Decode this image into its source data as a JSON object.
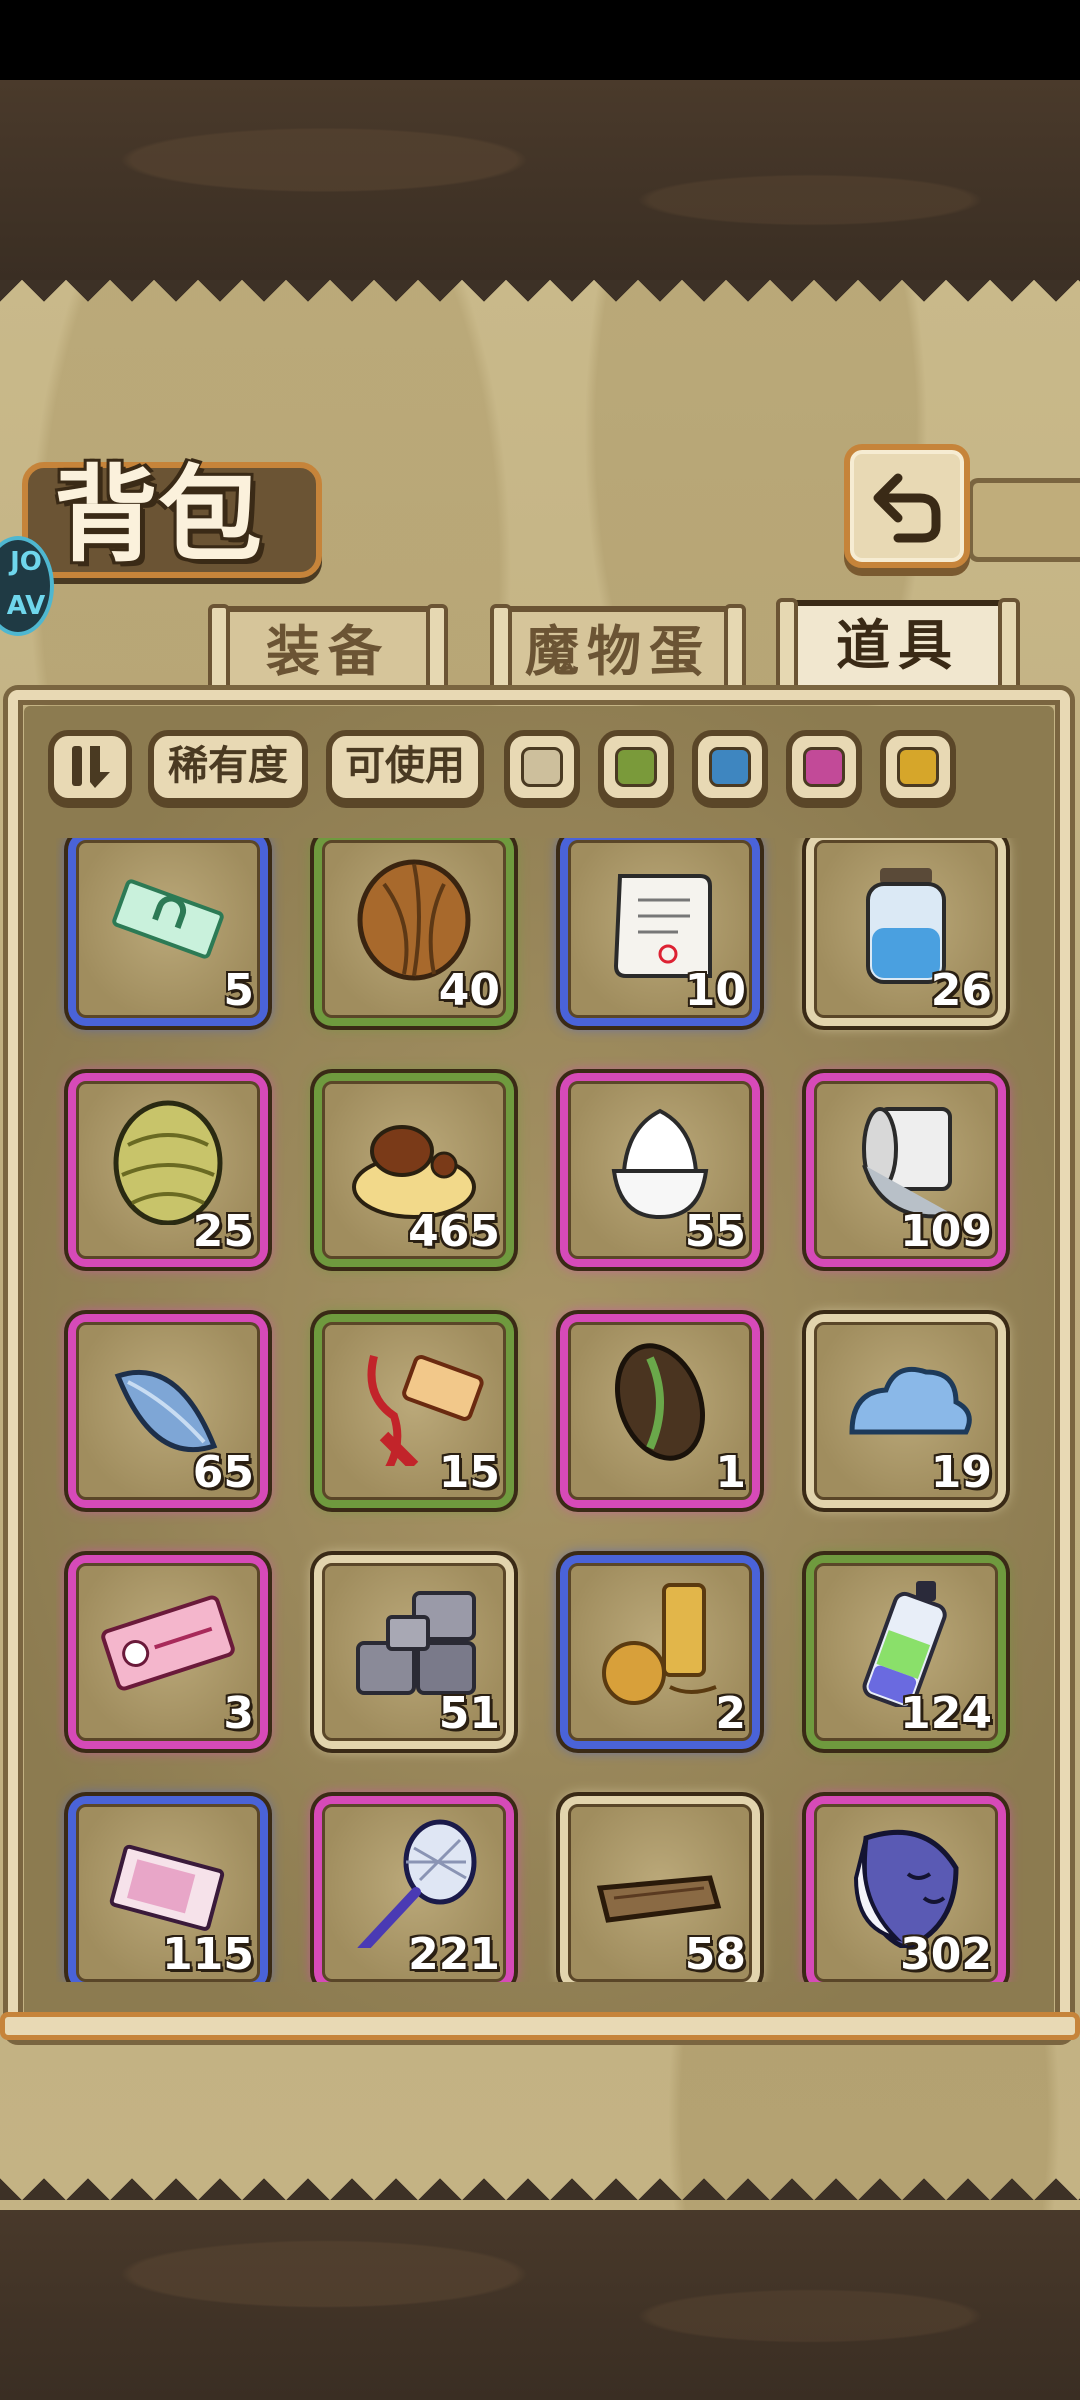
{
  "header": {
    "title": "背包",
    "logo_text": "JO AV"
  },
  "tabs": [
    {
      "label": "装备",
      "active": false
    },
    {
      "label": "魔物蛋",
      "active": false
    },
    {
      "label": "道具",
      "active": true
    }
  ],
  "filters": {
    "sort_icon": "sort-toggle-icon",
    "rarity_label": "稀有度",
    "usable_label": "可使用",
    "rarity_colors": [
      "#cdbf9c",
      "#7a9a3a",
      "#3e86c0",
      "#c24a98",
      "#d6a62a"
    ]
  },
  "rarity_border_colors": {
    "common": "#e2d4ad",
    "uncommon": "#6f9a3e",
    "rare": "#4a63d8",
    "epic": "#d64ab8"
  },
  "items": [
    {
      "name": "horseshoe-ticket-icon",
      "rarity": "rare",
      "count": "5"
    },
    {
      "name": "coconut-icon",
      "rarity": "uncommon",
      "count": "40"
    },
    {
      "name": "scroll-icon",
      "rarity": "rare",
      "count": "10"
    },
    {
      "name": "water-jar-icon",
      "rarity": "common",
      "count": "26"
    },
    {
      "name": "hop-cone-icon",
      "rarity": "epic",
      "count": "25"
    },
    {
      "name": "pudding-icon",
      "rarity": "uncommon",
      "count": "465"
    },
    {
      "name": "cream-bowl-icon",
      "rarity": "epic",
      "count": "55"
    },
    {
      "name": "paper-roll-icon",
      "rarity": "epic",
      "count": "109"
    },
    {
      "name": "feather-icon",
      "rarity": "epic",
      "count": "65"
    },
    {
      "name": "tassel-tag-icon",
      "rarity": "uncommon",
      "count": "15"
    },
    {
      "name": "bean-seed-icon",
      "rarity": "epic",
      "count": "1"
    },
    {
      "name": "slime-blob-icon",
      "rarity": "common",
      "count": "19"
    },
    {
      "name": "pink-ticket-icon",
      "rarity": "epic",
      "count": "3"
    },
    {
      "name": "stone-bricks-icon",
      "rarity": "common",
      "count": "51"
    },
    {
      "name": "golden-relics-icon",
      "rarity": "rare",
      "count": "2"
    },
    {
      "name": "potion-bottle-icon",
      "rarity": "uncommon",
      "count": "124"
    },
    {
      "name": "photo-ticket-icon",
      "rarity": "rare",
      "count": "115"
    },
    {
      "name": "bug-net-icon",
      "rarity": "epic",
      "count": "221"
    },
    {
      "name": "wood-plank-icon",
      "rarity": "common",
      "count": "58"
    },
    {
      "name": "mask-icon",
      "rarity": "epic",
      "count": "302"
    }
  ]
}
